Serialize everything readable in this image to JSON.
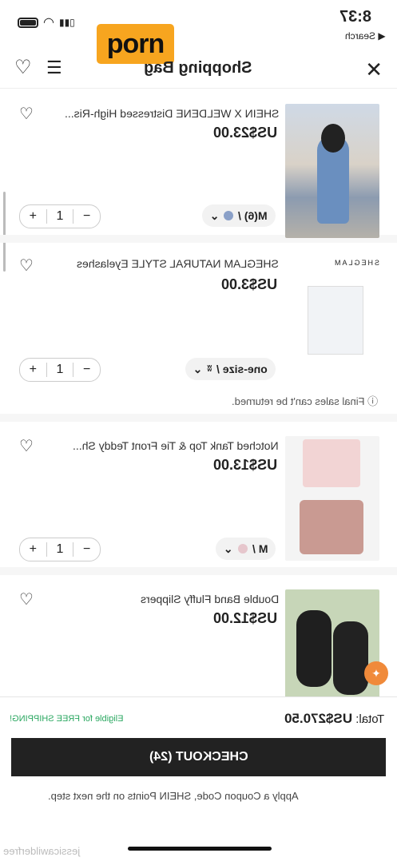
{
  "status": {
    "time": "8:37",
    "back_label": "◀ Search"
  },
  "overlay": {
    "label": "porn"
  },
  "header": {
    "title": "Shopping Bag"
  },
  "items": [
    {
      "name": "SHEIN X WELDENE Distressed High-Ris...",
      "price": "US$23.00",
      "variant": "M(6) /",
      "qty": "1",
      "note": ""
    },
    {
      "name": "SHEGLAM NATURAL STYLE Eyelashes",
      "price": "US$3.00",
      "variant": "one-size /",
      "qty": "1",
      "note": "ⓘ Final sales can't be returned.",
      "brand": "SHEGLAM"
    },
    {
      "name": "Notched Tank Top & Tie Front Teddy Sh...",
      "price": "US$13.00",
      "variant": "M /",
      "qty": "1",
      "note": ""
    },
    {
      "name": "Double Band Fluffy Slippers",
      "price": "US$12.00",
      "variant": "",
      "qty": "1",
      "note": ""
    }
  ],
  "footer": {
    "total_label": "Total:",
    "total_value": "US$270.50",
    "shipping": "Eligible for FREE SHIPPING!",
    "checkout": "CHECKOUT (24)",
    "coupon": "Apply a Coupon Code, SHEIN Points on the next step."
  },
  "watermark": "jessicawilderfree",
  "colors": {
    "accent_dark": "#222222",
    "free_shipping": "#2aa760",
    "overlay": "#f7a51f"
  }
}
